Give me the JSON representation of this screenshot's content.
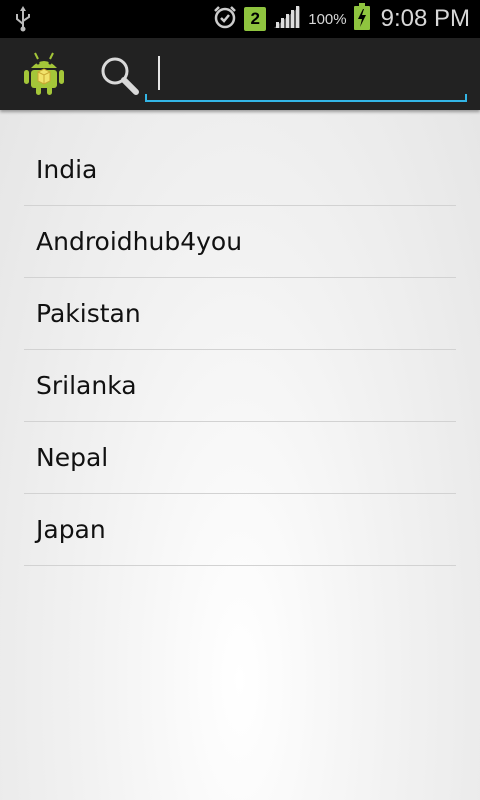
{
  "status_bar": {
    "notification_badge": "2",
    "battery": "100%",
    "time": "9:08 PM",
    "icons": [
      "usb-icon",
      "alarm-icon",
      "signal-icon",
      "battery-charging-icon"
    ]
  },
  "action_bar": {
    "app_icon": "android-icon",
    "search_icon": "search-icon",
    "search_value": "",
    "accent_color": "#33b5e5"
  },
  "list": {
    "items": [
      {
        "label": "India"
      },
      {
        "label": "Androidhub4you"
      },
      {
        "label": "Pakistan"
      },
      {
        "label": "Srilanka"
      },
      {
        "label": "Nepal"
      },
      {
        "label": "Japan"
      }
    ]
  }
}
